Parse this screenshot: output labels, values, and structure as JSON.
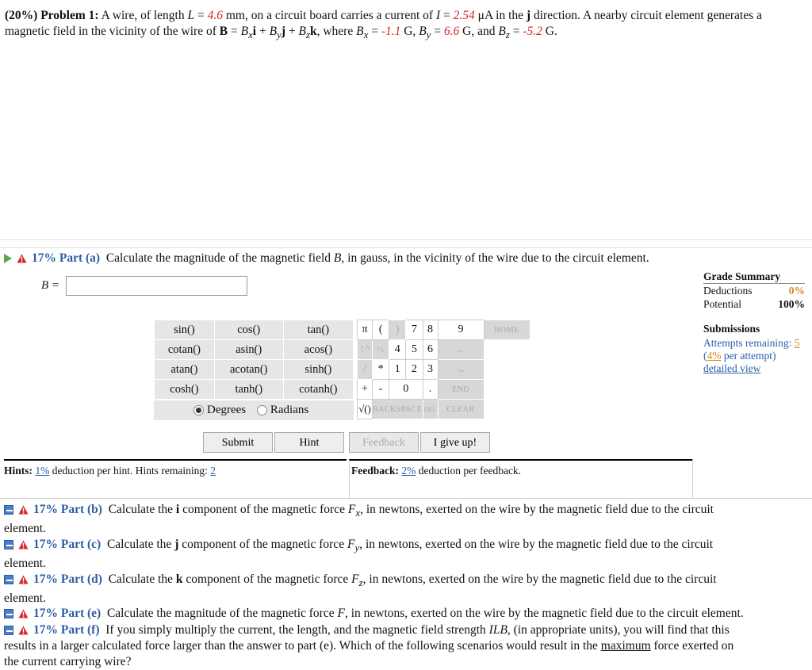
{
  "problem": {
    "weight": "(20%)",
    "label": "Problem 1:",
    "t1": "A wire, of length ",
    "L_sym": "L",
    "t2": " = ",
    "L_val": "4.6",
    "t3": " mm, on a circuit board carries a current of ",
    "I_sym": "I",
    "t4": " = ",
    "I_val": "2.54",
    "t5": " μA in the ",
    "j": "j",
    "t6": " direction. A nearby circuit element generates a magnetic field in the vicinity of the wire of ",
    "Bvec": "B",
    "t7": " = ",
    "bx_comp": "B",
    "bx_sub": "x",
    "i": "i",
    "plus1": " + ",
    "by_comp": "B",
    "by_sub": "y",
    "j2": "j",
    "plus2": " + ",
    "bz_comp": "B",
    "bz_sub": "z",
    "k": "k",
    "t8": ", where ",
    "Bx_sym": "B",
    "Bx_sub": "x",
    "eq1": " = ",
    "Bx_val": "-1.1",
    "g1": " G, ",
    "By_sym": "B",
    "By_sub": "y",
    "eq2": " = ",
    "By_val": "6.6",
    "g2": " G, and ",
    "Bz_sym": "B",
    "Bz_sub": "z",
    "eq3": " = ",
    "Bz_val": "-5.2",
    "g3": " G."
  },
  "part_a": {
    "pct": "17% Part (a)",
    "text": "Calculate the magnitude of the magnetic field ",
    "B": "B",
    "text2": ", in gauss, in the vicinity of the wire due to the circuit element.",
    "answer_label": "B =",
    "answer_value": ""
  },
  "calculator": {
    "functions": [
      [
        "sin()",
        "cos()",
        "tan()"
      ],
      [
        "cotan()",
        "asin()",
        "acos()"
      ],
      [
        "atan()",
        "acotan()",
        "sinh()"
      ],
      [
        "cosh()",
        "tanh()",
        "cotanh()"
      ]
    ],
    "degrees": "Degrees",
    "radians": "Radians",
    "keys": {
      "pi": "π",
      "lparen": "(",
      "rparen": ")",
      "up": "↑^",
      "down": "^↓",
      "slash": "/",
      "star": "*",
      "plus": "+",
      "minus": "-",
      "sqrt": "√()",
      "dot": ".",
      "d7": "7",
      "d8": "8",
      "d9": "9",
      "d4": "4",
      "d5": "5",
      "d6": "6",
      "d1": "1",
      "d2": "2",
      "d3": "3",
      "d0": "0",
      "home": "HOME",
      "left": "←",
      "right": "→",
      "end": "END",
      "backspace": "BACKSPACE",
      "del": "DEL",
      "clear": "CLEAR"
    }
  },
  "buttons": {
    "submit": "Submit",
    "hint": "Hint",
    "feedback": "Feedback",
    "giveup": "I give up!"
  },
  "hints": {
    "label": "Hints:",
    "pct": "1%",
    "text": " deduction per hint. Hints remaining: ",
    "remaining": "2"
  },
  "feedback": {
    "label": "Feedback:",
    "pct": "2%",
    "text": " deduction per feedback."
  },
  "grade_summary": {
    "title": "Grade Summary",
    "deductions_label": "Deductions",
    "deductions_value": "0%",
    "potential_label": "Potential",
    "potential_value": "100%"
  },
  "submissions": {
    "title": "Submissions",
    "attempts_label": "Attempts remaining: ",
    "attempts_value": "5",
    "per_attempt_pct": "4%",
    "per_attempt_text": " per attempt)",
    "detailed": "detailed view"
  },
  "parts": {
    "b": {
      "pct": "17% Part (b)",
      "t1": "Calculate the ",
      "comp": "i",
      "t2": " component of the magnetic force ",
      "F": "F",
      "sub": "x",
      "t3": ", in newtons, exerted on the wire by the magnetic field due to the circuit",
      "t4": "element."
    },
    "c": {
      "pct": "17% Part (c)",
      "t1": "Calculate the ",
      "comp": "j",
      "t2": " component of the magnetic force ",
      "F": "F",
      "sub": "y",
      "t3": ", in newtons, exerted on the wire by the magnetic field due to the circuit",
      "t4": "element."
    },
    "d": {
      "pct": "17% Part (d)",
      "t1": "Calculate the ",
      "comp": "k",
      "t2": " component of the magnetic force ",
      "F": "F",
      "sub": "z",
      "t3": ", in newtons, exerted on the wire by the magnetic field due to the circuit",
      "t4": "element."
    },
    "e": {
      "pct": "17% Part (e)",
      "t1": "Calculate the magnitude of the magnetic force ",
      "F": "F",
      "t2": ", in newtons, exerted on the wire by the magnetic field due to the circuit element."
    },
    "f": {
      "pct": "17% Part (f)",
      "t1": "If you simply multiply the current, the length, and the magnetic field strength ",
      "ILB": "ILB",
      "t2": ", (in appropriate units), you will find that this",
      "t3": "results in a larger calculated force larger than the answer to part (e). Which of the following scenarios would result in the ",
      "maximum": "maximum",
      "t4": " force exerted on",
      "t5": "the current carrying wire?"
    }
  }
}
